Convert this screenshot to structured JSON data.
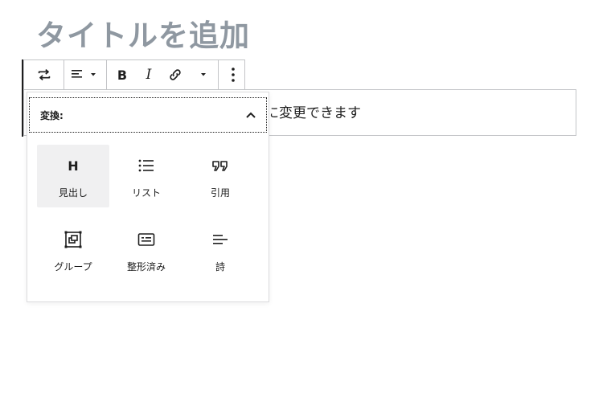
{
  "editor": {
    "title_placeholder": "タイトルを追加",
    "paragraph_text_visible": "に変更できます"
  },
  "toolbar": {
    "buttons": [
      {
        "name": "transform",
        "icon": "transform-arrows-icon"
      },
      {
        "name": "align",
        "icon": "align-left-icon"
      },
      {
        "name": "bold",
        "label": "B"
      },
      {
        "name": "italic",
        "label": "I"
      },
      {
        "name": "link",
        "icon": "link-icon"
      },
      {
        "name": "more-rich-text",
        "icon": "chevron-down-icon"
      },
      {
        "name": "options",
        "icon": "more-vertical-icon"
      }
    ]
  },
  "transform_menu": {
    "label": "変換:",
    "items": [
      {
        "label": "見出し",
        "icon": "heading-icon",
        "icon_text": "H",
        "active": true
      },
      {
        "label": "リスト",
        "icon": "list-icon"
      },
      {
        "label": "引用",
        "icon": "quote-icon"
      },
      {
        "label": "グループ",
        "icon": "group-icon"
      },
      {
        "label": "整形済み",
        "icon": "preformatted-icon"
      },
      {
        "label": "詩",
        "icon": "verse-icon"
      }
    ]
  }
}
